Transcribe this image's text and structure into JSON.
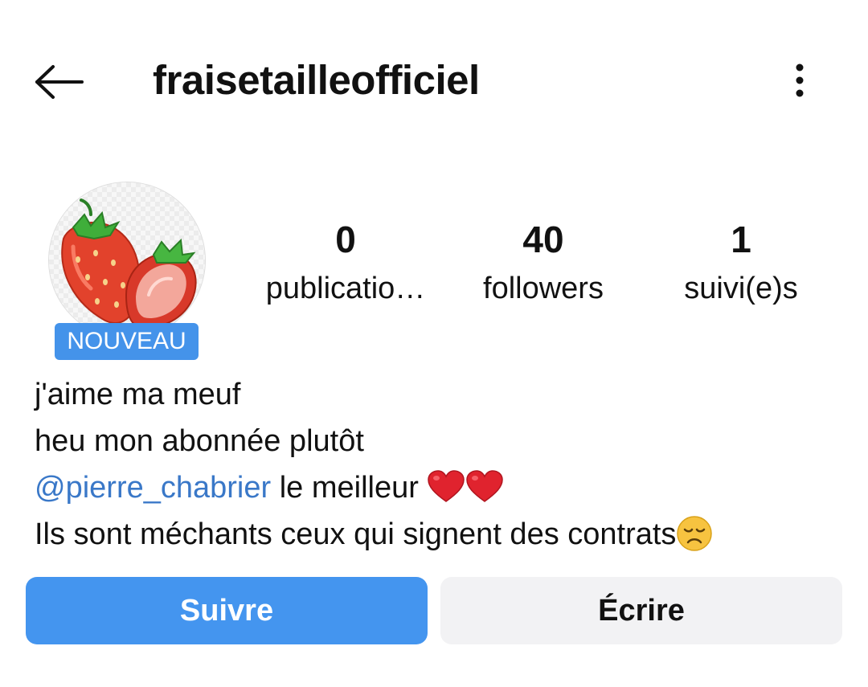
{
  "header": {
    "username": "fraisetailleofficiel",
    "back_icon": "arrow-left-icon",
    "more_icon": "more-vertical-icon"
  },
  "profile": {
    "avatar_description_icon": "strawberry-avatar",
    "badge": "NOUVEAU"
  },
  "stats": [
    {
      "count": "0",
      "label": "publicatio…"
    },
    {
      "count": "40",
      "label": "followers"
    },
    {
      "count": "1",
      "label": "suivi(e)s"
    }
  ],
  "bio": {
    "line1": "j'aime ma meuf",
    "line2": "heu mon abonnée plutôt",
    "mention": "@pierre_chabrier",
    "line3_rest": " le meilleur ",
    "line4": "Ils sont méchants ceux qui signent des contrats"
  },
  "actions": {
    "follow_label": "Suivre",
    "message_label": "Écrire"
  },
  "colors": {
    "accent": "#4495ef",
    "badge": "#4493ea",
    "mention": "#3a78c8",
    "secondary_button": "#f2f2f4"
  }
}
